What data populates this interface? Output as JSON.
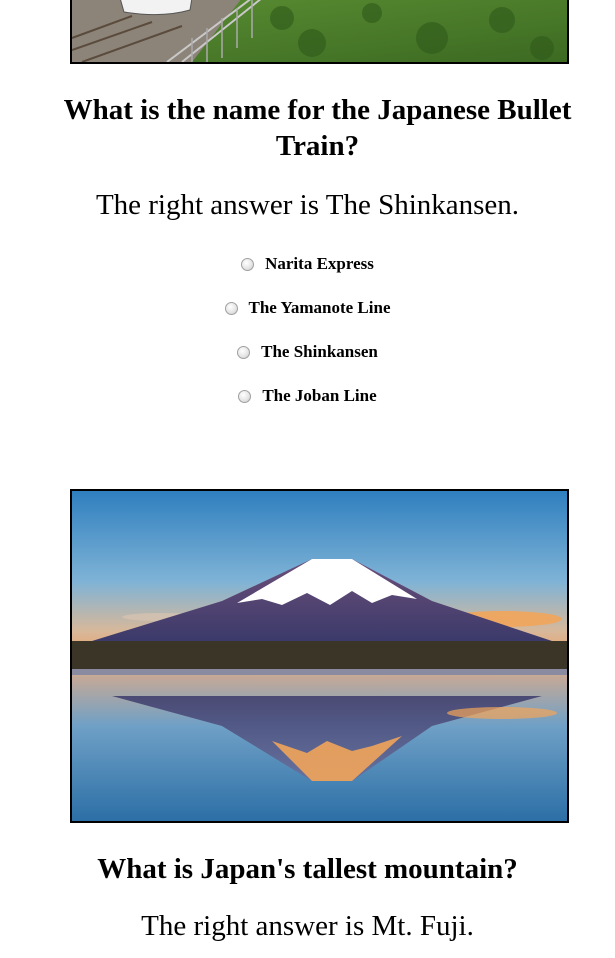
{
  "quiz": {
    "questions": [
      {
        "question": "What is the name for the Japanese Bullet Train?",
        "answer_text": "The right answer is The Shinkansen.",
        "options": [
          "Narita Express",
          "The Yamanote Line",
          "The Shinkansen",
          "The Joban Line"
        ]
      },
      {
        "question": "What is Japan's tallest mountain?",
        "answer_text": "The right answer is Mt. Fuji."
      }
    ]
  },
  "images": {
    "top_photo": "bullet-train-photo",
    "fuji_photo": "mount-fuji-photo"
  }
}
